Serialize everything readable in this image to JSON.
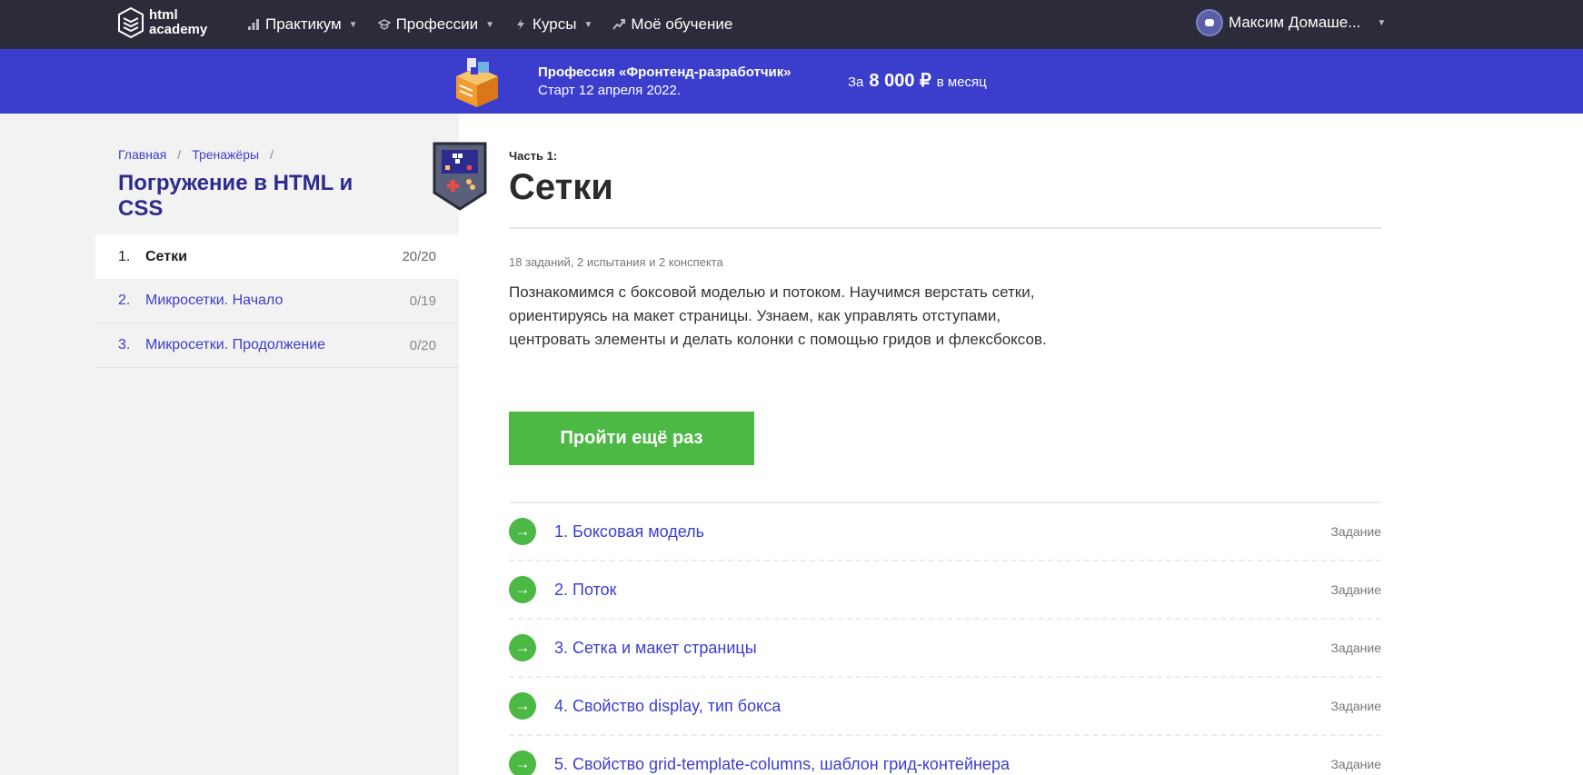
{
  "header": {
    "logo_text_1": "html",
    "logo_text_2": "academy",
    "nav": [
      {
        "label": "Практикум",
        "icon": "chart-icon",
        "dropdown": true
      },
      {
        "label": "Профессии",
        "icon": "graduation-cap-icon",
        "dropdown": true
      },
      {
        "label": "Курсы",
        "icon": "lightning-icon",
        "dropdown": true
      },
      {
        "label": "Моё обучение",
        "icon": "progress-icon",
        "dropdown": false
      }
    ],
    "user_name": "Максим Домаше..."
  },
  "promo": {
    "title": "Профессия «Фронтенд-разработчик»",
    "subtitle": "Старт 12 апреля 2022.",
    "price_prefix": "За",
    "price": "8 000 ₽",
    "price_suffix": "в месяц"
  },
  "sidebar": {
    "breadcrumbs": [
      "Главная",
      "Тренажёры"
    ],
    "course_title": "Погружение в HTML и CSS",
    "chapters": [
      {
        "num": "1.",
        "name": "Сетки",
        "count": "20/20",
        "active": true
      },
      {
        "num": "2.",
        "name": "Микросетки. Начало",
        "count": "0/19",
        "active": false
      },
      {
        "num": "3.",
        "name": "Микросетки. Продолжение",
        "count": "0/20",
        "active": false
      }
    ]
  },
  "main": {
    "part_label": "Часть 1:",
    "title": "Сетки",
    "meta": "18 заданий, 2 испытания и 2 конспекта",
    "description": "Познакомимся с боксовой моделью и потоком. Научимся верстать сетки, ориентируясь на макет страницы. Узнаем, как управлять отступами, центровать элементы и делать колонки с помощью гридов и флексбоксов.",
    "cta_label": "Пройти ещё раз",
    "tasks": [
      {
        "name": "1. Боксовая модель",
        "type": "Задание"
      },
      {
        "name": "2. Поток",
        "type": "Задание"
      },
      {
        "name": "3. Сетка и макет страницы",
        "type": "Задание"
      },
      {
        "name": "4. Свойство display, тип бокса",
        "type": "Задание"
      },
      {
        "name": "5. Свойство grid-template-columns, шаблон грид-контейнера",
        "type": "Задание"
      }
    ]
  },
  "colors": {
    "header_bg": "#2b2b3a",
    "promo_bg": "#3b3ecd",
    "accent": "#3b3ecd",
    "title_accent": "#2d2b8f",
    "success": "#4cb944"
  }
}
